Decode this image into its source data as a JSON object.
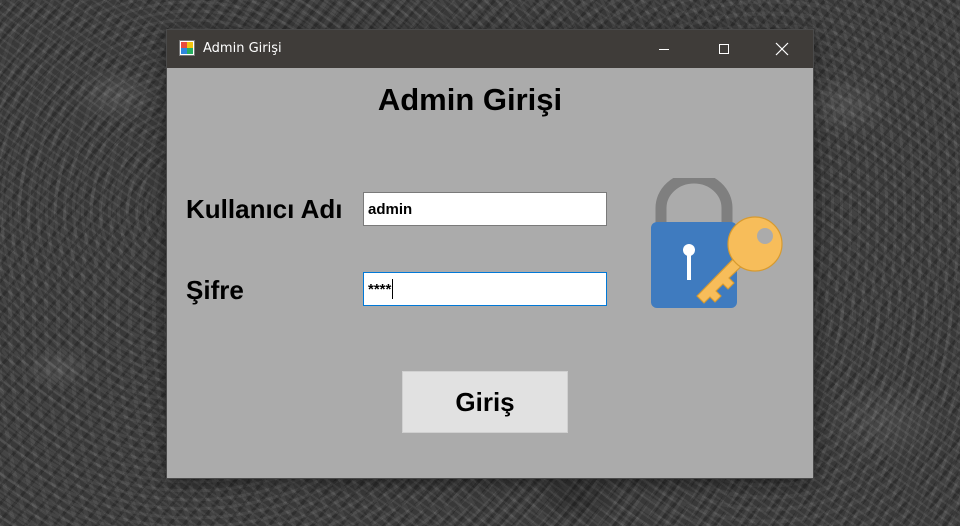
{
  "window": {
    "title": "Admin Girişi",
    "controls": {
      "minimize": "minimize-icon",
      "maximize": "maximize-icon",
      "close": "close-icon"
    }
  },
  "form": {
    "heading": "Admin Girişi",
    "username_label": "Kullanıcı Adı",
    "username_value": "admin",
    "password_label": "Şifre",
    "password_value": "****",
    "submit_label": "Giriş"
  },
  "illustration": {
    "icons": [
      "padlock-icon",
      "key-icon"
    ]
  },
  "colors": {
    "titlebar": "#3f3c39",
    "window_bg": "#ababab",
    "focus_border": "#0078d7",
    "padlock_body": "#3f7bbf",
    "padlock_shackle": "#7f7f7f",
    "key": "#f7bd5a",
    "button_bg": "#e1e1e1"
  }
}
